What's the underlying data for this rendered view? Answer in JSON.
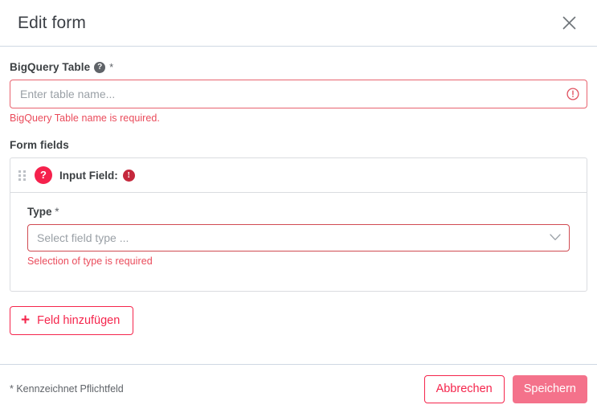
{
  "dialog": {
    "title": "Edit form",
    "close_icon": "close-icon"
  },
  "bigquery": {
    "label": "BigQuery Table",
    "help_icon": "help-circle-icon",
    "help_glyph": "?",
    "required_marker": "*",
    "input_value": "",
    "input_placeholder": "Enter table name...",
    "error_icon": "error-circle-icon",
    "error_text": "BigQuery Table name is required."
  },
  "form_fields": {
    "section_label": "Form fields",
    "cards": [
      {
        "drag_handle_icon": "drag-handle-icon",
        "type_icon": "unknown-field-type-icon",
        "type_icon_glyph": "?",
        "title": "Input Field:",
        "alert_icon": "alert-circle-icon",
        "alert_glyph": "!",
        "type_label": "Type",
        "type_required_marker": "*",
        "select_value": "",
        "select_placeholder": "Select field type ...",
        "chevron_icon": "chevron-down-icon",
        "error_text": "Selection of type is required"
      }
    ],
    "add_button_label": "Feld hinzufügen",
    "add_button_icon": "plus-icon",
    "add_button_glyph": "+"
  },
  "footer": {
    "required_note": "* Kennzeichnet Pflichtfeld",
    "cancel_label": "Abbrechen",
    "save_label": "Speichern"
  },
  "colors": {
    "accent_pink": "#F5254C",
    "save_button": "#F4728B",
    "error_text": "#EA4B5B",
    "error_border": "#E8636F",
    "alert_icon": "#C5283C",
    "divider": "#CFD8E3",
    "card_border": "#DADCE0",
    "placeholder": "#9AA0A6",
    "help_icon": "#5F6368"
  }
}
